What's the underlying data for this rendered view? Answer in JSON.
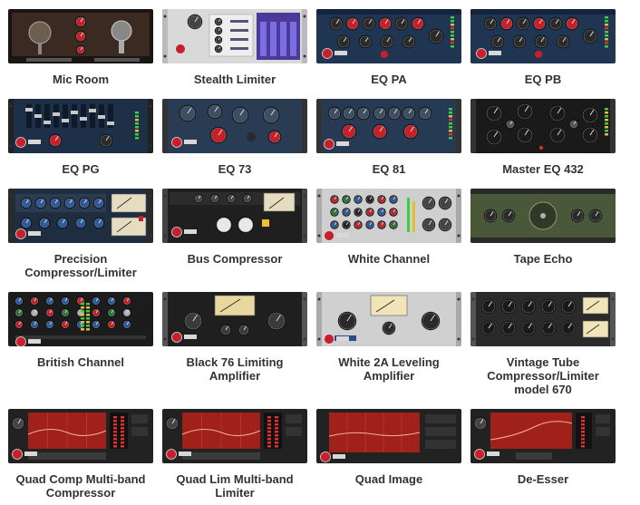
{
  "plugins": [
    {
      "lines": [
        "Mic Room"
      ],
      "theme": "microom"
    },
    {
      "lines": [
        "Stealth Limiter"
      ],
      "theme": "stealth"
    },
    {
      "lines": [
        "EQ PA"
      ],
      "theme": "eqpa"
    },
    {
      "lines": [
        "EQ PB"
      ],
      "theme": "eqpa"
    },
    {
      "lines": [
        "EQ PG"
      ],
      "theme": "eqpg"
    },
    {
      "lines": [
        "EQ 73"
      ],
      "theme": "eq73"
    },
    {
      "lines": [
        "EQ 81"
      ],
      "theme": "eq81"
    },
    {
      "lines": [
        "Master EQ 432"
      ],
      "theme": "master"
    },
    {
      "lines": [
        "Precision",
        "Compressor/Limiter"
      ],
      "theme": "precision"
    },
    {
      "lines": [
        "Bus Compressor"
      ],
      "theme": "bus"
    },
    {
      "lines": [
        "White Channel"
      ],
      "theme": "white"
    },
    {
      "lines": [
        "Tape Echo"
      ],
      "theme": "tape"
    },
    {
      "lines": [
        "British Channel"
      ],
      "theme": "british"
    },
    {
      "lines": [
        "Black 76 Limiting",
        "Amplifier"
      ],
      "theme": "black76"
    },
    {
      "lines": [
        "White 2A Leveling",
        "Amplifier"
      ],
      "theme": "white2a"
    },
    {
      "lines": [
        "Vintage Tube",
        "Compressor/Limiter",
        "model 670"
      ],
      "theme": "vintage"
    },
    {
      "lines": [
        "Quad Comp Multi-band",
        "Compressor"
      ],
      "theme": "quad"
    },
    {
      "lines": [
        "Quad Lim Multi-band",
        "Limiter"
      ],
      "theme": "quad"
    },
    {
      "lines": [
        "Quad Image"
      ],
      "theme": "quadimage"
    },
    {
      "lines": [
        "De-Esser"
      ],
      "theme": "deesser"
    }
  ],
  "brand_colors": {
    "accent_red": "#c8202a",
    "panel_navy": "#1f3552",
    "panel_black": "#1c1c1c",
    "label_text": "#333333"
  }
}
